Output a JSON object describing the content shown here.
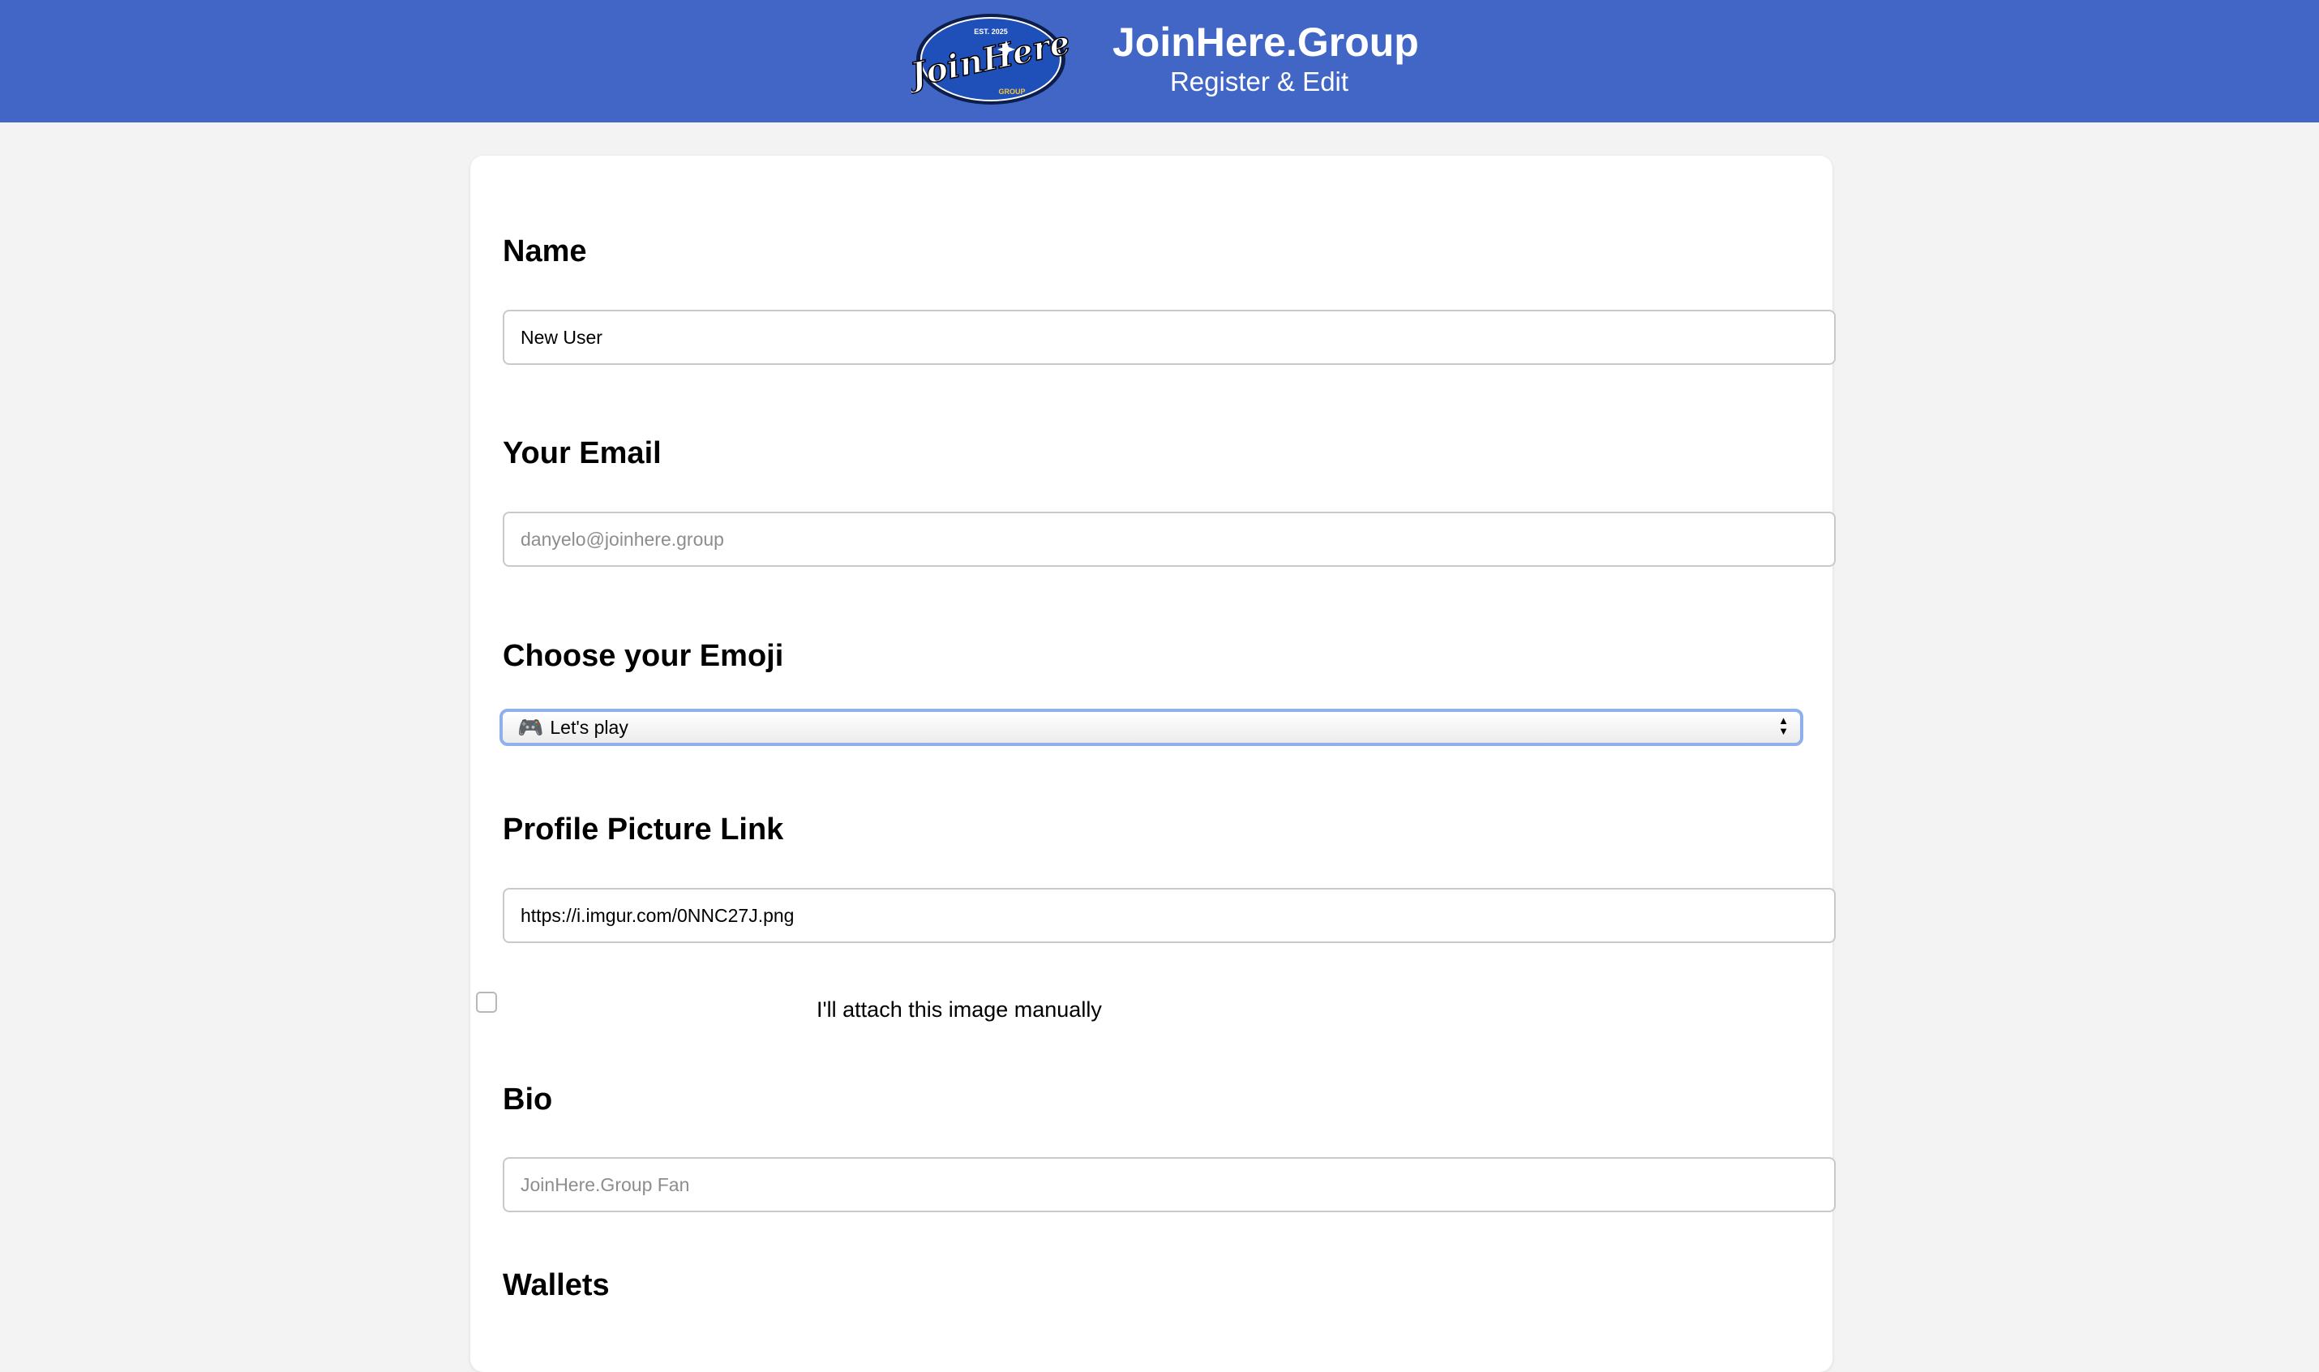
{
  "header": {
    "brand_title": "JoinHere.Group",
    "brand_subtitle": "Register & Edit",
    "logo": {
      "script_text": "JoinHere",
      "top_text": "EST. 2025",
      "bottom_text": "GROUP"
    },
    "colors": {
      "background": "#4166c6",
      "logo_badge": "#1f4fb8"
    }
  },
  "form": {
    "name": {
      "label": "Name",
      "value": "New User",
      "placeholder": ""
    },
    "email": {
      "label": "Your Email",
      "value": "",
      "placeholder": "danyelo@joinhere.group"
    },
    "emoji": {
      "label": "Choose your Emoji",
      "selected_icon": "🎮",
      "selected_text": "Let's play"
    },
    "profile_picture": {
      "label": "Profile Picture Link",
      "value": "https://i.imgur.com/0NNC27J.png",
      "manual_attach": {
        "label": "I'll attach this image manually",
        "checked": false
      }
    },
    "bio": {
      "label": "Bio",
      "value": "",
      "placeholder": "JoinHere.Group Fan"
    },
    "wallets": {
      "label": "Wallets"
    }
  },
  "icons": {
    "select_arrows": "select-arrows-icon",
    "logo": "joinhere-logo"
  }
}
